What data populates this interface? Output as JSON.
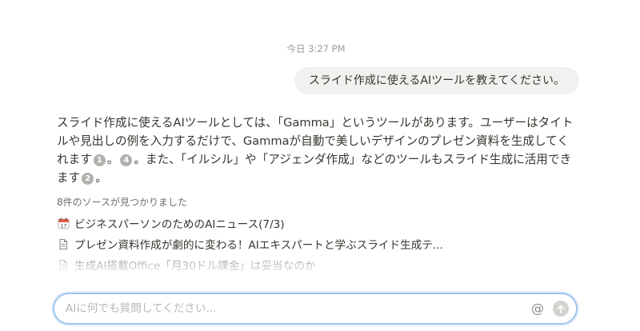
{
  "chat": {
    "timestamp": "今日 3:27 PM",
    "user_message": "スライド作成に使えるAIツールを教えてください。",
    "answer": {
      "part1": "スライド作成に使えるAIツールとしては、「Gamma」というツールがあります。ユーザーはタイトルや見出しの例を入力するだけで、Gammaが自動で美しいデザインのプレゼン資料を生成してくれます",
      "cite1": "1",
      "part2": "。",
      "cite2": "4",
      "part3": "。また、「イルシル」や「アジェンダ作成」などのツールもスライド生成に活用できます",
      "cite3": "2",
      "part4": "。"
    },
    "sources": {
      "label": "8件のソースが見つかりました",
      "items": [
        {
          "icon": "calendar-icon",
          "title": "ビジネスパーソンのためのAIニュース(7/3)"
        },
        {
          "icon": "page-icon",
          "title": "プレゼン資料作成が劇的に変わる！AIエキスパートと学ぶスライド生成テ..."
        },
        {
          "icon": "page-icon",
          "title": "生成AI搭載Office「月30ドル課金」は妥当なのか"
        }
      ]
    }
  },
  "composer": {
    "placeholder": "AIに何でも質問してください...",
    "value": "",
    "mention_label": "@"
  },
  "colors": {
    "input_border": "#9ec5ea",
    "citation_badge": "#b3b1ad",
    "bubble_bg": "#f1f1ef"
  }
}
